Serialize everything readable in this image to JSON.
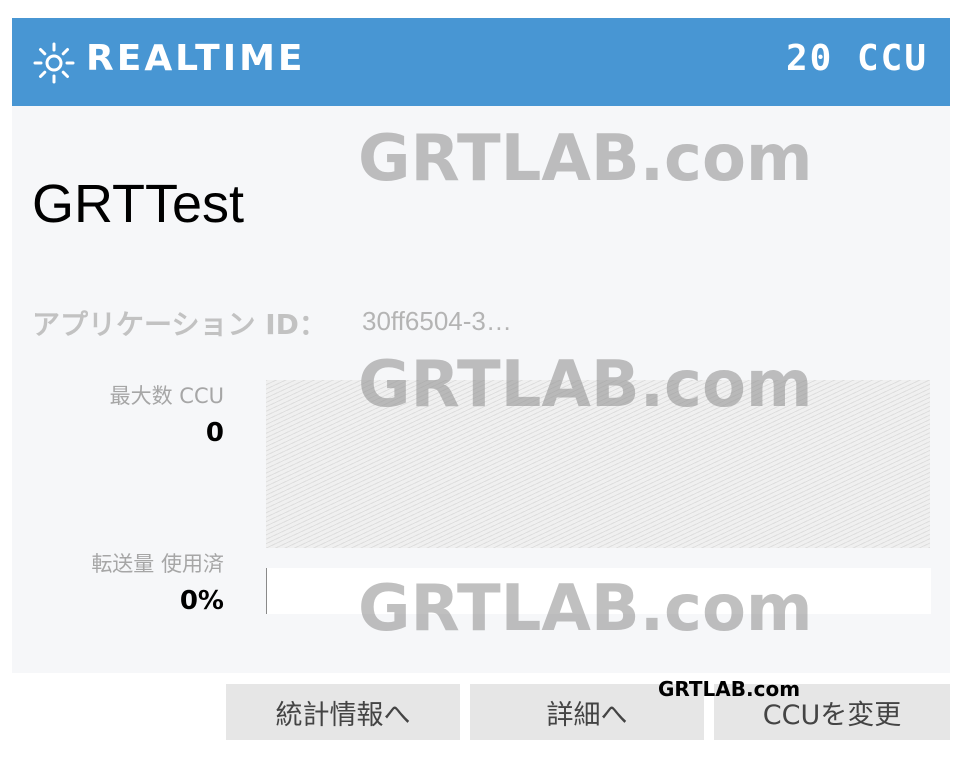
{
  "header": {
    "title": "REALTIME",
    "ccu": "20 CCU",
    "icon": "sun-icon",
    "background_color": "#4896d3"
  },
  "app": {
    "name": "GRTTest",
    "id_label": "アプリケーション ID：",
    "id_value": "30ff6504-3…"
  },
  "stats": {
    "max_ccu_label": "最大数 CCU",
    "max_ccu_value": "0",
    "transfer_label": "転送量 使用済",
    "transfer_value": "0%",
    "transfer_fraction": 0
  },
  "watermarks": [
    "GRTLAB.com",
    "GRTLAB.com",
    "GRTLAB.com",
    "GRTLAB.com"
  ],
  "buttons": {
    "stats": "統計情報へ",
    "details": "詳細へ",
    "change_ccu": "CCUを変更"
  }
}
